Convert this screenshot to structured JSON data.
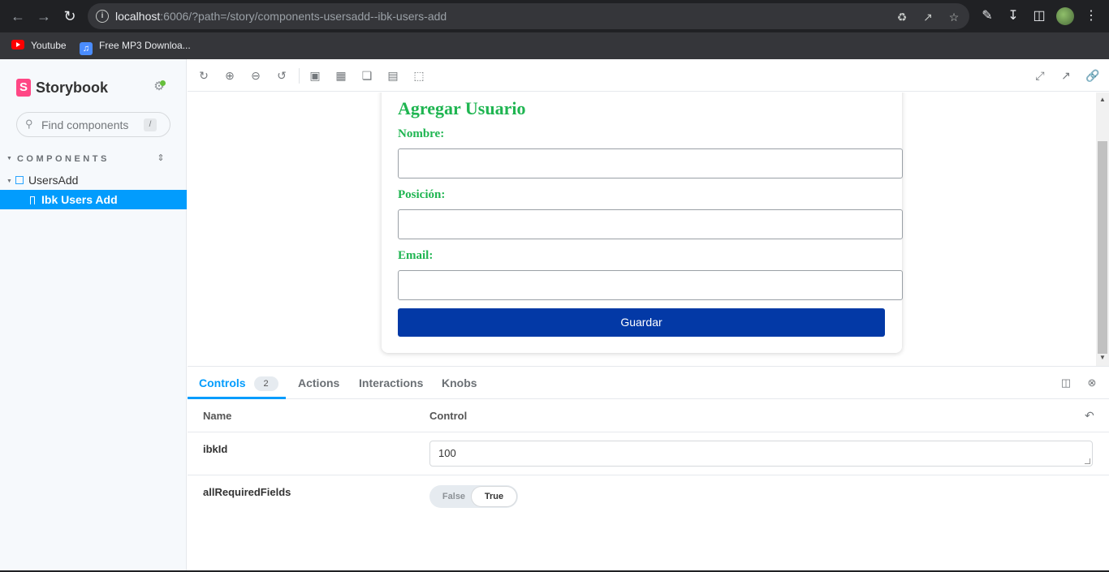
{
  "browser": {
    "url_host": "localhost",
    "url_rest": ":6006/?path=/story/components-usersadd--ibk-users-add",
    "bookmarks": [
      {
        "label": "Youtube",
        "icon": "youtube-icon"
      },
      {
        "label": "Free MP3 Downloa...",
        "icon": "music-icon"
      }
    ]
  },
  "sidebar": {
    "brand": "Storybook",
    "search_placeholder": "Find components",
    "search_shortcut": "/",
    "section": "COMPONENTS",
    "component": "UsersAdd",
    "story": "Ibk Users Add"
  },
  "form": {
    "title": "Agregar Usuario",
    "fields": [
      {
        "label": "Nombre:",
        "value": ""
      },
      {
        "label": "Posición:",
        "value": ""
      },
      {
        "label": "Email:",
        "value": ""
      }
    ],
    "button": "Guardar",
    "colors": {
      "label": "#1fb551",
      "button": "#0339a6"
    }
  },
  "panel": {
    "tabs": [
      {
        "label": "Controls",
        "badge": "2"
      },
      {
        "label": "Actions"
      },
      {
        "label": "Interactions"
      },
      {
        "label": "Knobs"
      }
    ],
    "columns": {
      "name": "Name",
      "control": "Control"
    },
    "rows": [
      {
        "name": "ibkId",
        "value": "100"
      },
      {
        "name": "allRequiredFields",
        "false_label": "False",
        "true_label": "True",
        "selected": "True"
      }
    ]
  },
  "colors": {
    "accent": "#029cfd",
    "storybook_pink": "#ff4785"
  }
}
